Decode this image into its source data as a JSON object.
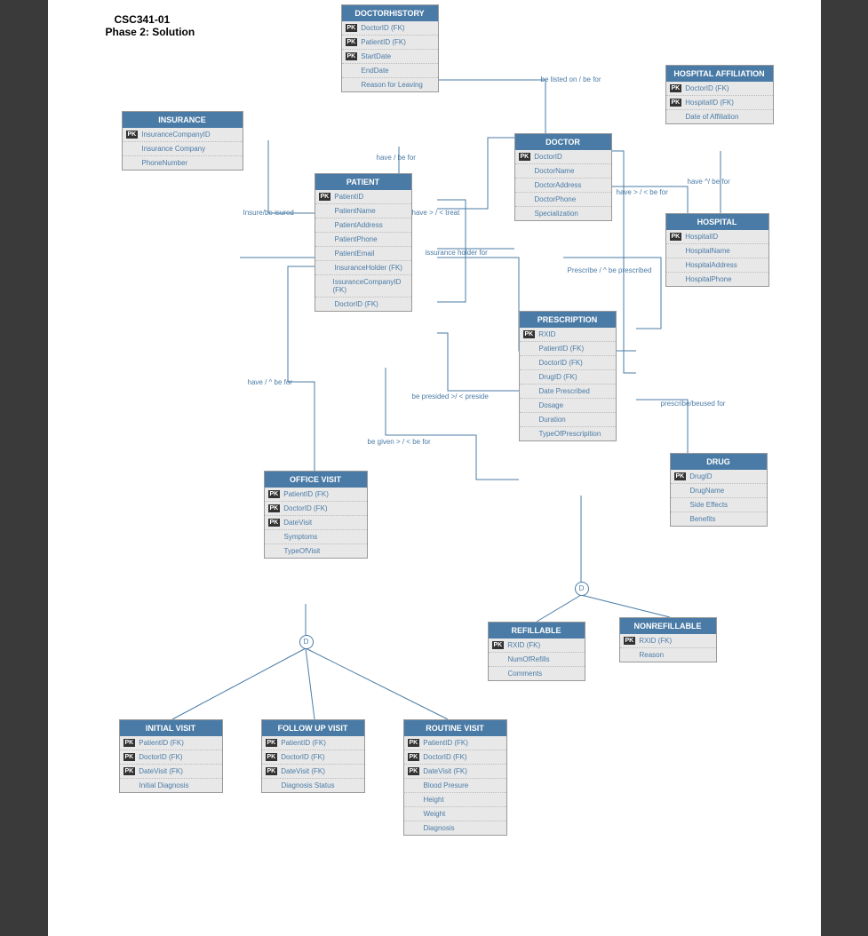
{
  "header": {
    "course": "CSC341-01",
    "phase": "Phase 2: Solution"
  },
  "entities": {
    "doctorhistory": {
      "title": "DOCTORHISTORY",
      "rows": [
        {
          "pk": true,
          "t": "DoctorID (FK)"
        },
        {
          "pk": true,
          "t": "PatientID (FK)"
        },
        {
          "pk": true,
          "t": "StartDate"
        },
        {
          "pk": false,
          "t": "EndDate"
        },
        {
          "pk": false,
          "t": "Reason for Leaving"
        }
      ]
    },
    "insurance": {
      "title": "INSURANCE",
      "rows": [
        {
          "pk": true,
          "t": "InsuranceCompanyID"
        },
        {
          "pk": false,
          "t": "Insurance Company"
        },
        {
          "pk": false,
          "t": "PhoneNumber"
        }
      ]
    },
    "doctor": {
      "title": "DOCTOR",
      "rows": [
        {
          "pk": true,
          "t": "DoctorID"
        },
        {
          "pk": false,
          "t": "DoctorName"
        },
        {
          "pk": false,
          "t": "DoctorAddress"
        },
        {
          "pk": false,
          "t": "DoctorPhone"
        },
        {
          "pk": false,
          "t": "Specialization"
        }
      ]
    },
    "hospitalaffiliation": {
      "title": "HOSPITAL AFFILIATION",
      "rows": [
        {
          "pk": true,
          "t": "DoctorID (FK)"
        },
        {
          "pk": true,
          "t": "HospitalID (FK)"
        },
        {
          "pk": false,
          "t": "Date of Affiliation"
        }
      ]
    },
    "patient": {
      "title": "PATIENT",
      "rows": [
        {
          "pk": true,
          "t": "PatientID"
        },
        {
          "pk": false,
          "t": "PatientName"
        },
        {
          "pk": false,
          "t": "PatientAddress"
        },
        {
          "pk": false,
          "t": "PatientPhone"
        },
        {
          "pk": false,
          "t": "PatientEmail"
        },
        {
          "pk": false,
          "t": "InsuranceHolder (FK)"
        },
        {
          "pk": false,
          "t": "IssuranceCompanyID (FK)"
        },
        {
          "pk": false,
          "t": "DoctorID (FK)"
        }
      ]
    },
    "hospital": {
      "title": "HOSPITAL",
      "rows": [
        {
          "pk": true,
          "t": "HospitalID"
        },
        {
          "pk": false,
          "t": "HospitalName"
        },
        {
          "pk": false,
          "t": "HospitalAddress"
        },
        {
          "pk": false,
          "t": "HospitalPhone"
        }
      ]
    },
    "prescription": {
      "title": "PRESCRIPTION",
      "rows": [
        {
          "pk": true,
          "t": "RXID"
        },
        {
          "pk": false,
          "t": "PatientID (FK)"
        },
        {
          "pk": false,
          "t": "DoctorID (FK)"
        },
        {
          "pk": false,
          "t": "DrugID (FK)"
        },
        {
          "pk": false,
          "t": "Date Prescribed"
        },
        {
          "pk": false,
          "t": "Dosage"
        },
        {
          "pk": false,
          "t": "Duration"
        },
        {
          "pk": false,
          "t": "TypeOfPrescripition"
        }
      ]
    },
    "drug": {
      "title": "DRUG",
      "rows": [
        {
          "pk": true,
          "t": "DrugID"
        },
        {
          "pk": false,
          "t": "DrugName"
        },
        {
          "pk": false,
          "t": "Side Effects"
        },
        {
          "pk": false,
          "t": "Benefits"
        }
      ]
    },
    "officevisit": {
      "title": "OFFICE VISIT",
      "rows": [
        {
          "pk": true,
          "t": "PatientID (FK)"
        },
        {
          "pk": true,
          "t": "DoctorID (FK)"
        },
        {
          "pk": true,
          "t": "DateVisit"
        },
        {
          "pk": false,
          "t": "Symptoms"
        },
        {
          "pk": false,
          "t": "TypeOfVisit"
        }
      ]
    },
    "refillable": {
      "title": "REFILLABLE",
      "rows": [
        {
          "pk": true,
          "t": "RXID (FK)"
        },
        {
          "pk": false,
          "t": "NumOfRefills"
        },
        {
          "pk": false,
          "t": "Comments"
        }
      ]
    },
    "nonrefillable": {
      "title": "NONREFILLABLE",
      "rows": [
        {
          "pk": true,
          "t": "RXID (FK)"
        },
        {
          "pk": false,
          "t": "Reason"
        }
      ]
    },
    "initialvisit": {
      "title": "INITIAL VISIT",
      "rows": [
        {
          "pk": true,
          "t": "PatientID (FK)"
        },
        {
          "pk": true,
          "t": "DoctorID (FK)"
        },
        {
          "pk": true,
          "t": "DateVisit (FK)"
        },
        {
          "pk": false,
          "t": "Initial Diagnosis"
        }
      ]
    },
    "followupvisit": {
      "title": "FOLLOW UP VISIT",
      "rows": [
        {
          "pk": true,
          "t": "PatientID (FK)"
        },
        {
          "pk": true,
          "t": "DoctorID (FK)"
        },
        {
          "pk": true,
          "t": "DateVisit (FK)"
        },
        {
          "pk": false,
          "t": "Diagnosis Status"
        }
      ]
    },
    "routinevisit": {
      "title": "ROUTINE VISIT",
      "rows": [
        {
          "pk": true,
          "t": "PatientID (FK)"
        },
        {
          "pk": true,
          "t": "DoctorID (FK)"
        },
        {
          "pk": true,
          "t": "DateVisit (FK)"
        },
        {
          "pk": false,
          "t": "Blood Presure"
        },
        {
          "pk": false,
          "t": "Height"
        },
        {
          "pk": false,
          "t": "Weight"
        },
        {
          "pk": false,
          "t": "Diagnosis"
        }
      ]
    }
  },
  "labels": {
    "l1": "be listed on / be for",
    "l2": "have / be for",
    "l3": "have ^/ be for",
    "l4": "have > / < be for",
    "l5": "Insure/be isured",
    "l6": "have > / <  treat",
    "l7": "issurance holder for",
    "l8": "Prescribe / ^ be prescribed",
    "l9": "have  / ^  be for",
    "l10": "be presided >/ < preside",
    "l11": "be given > / < be for",
    "l12": "prescribe/beused for",
    "d": "D"
  }
}
